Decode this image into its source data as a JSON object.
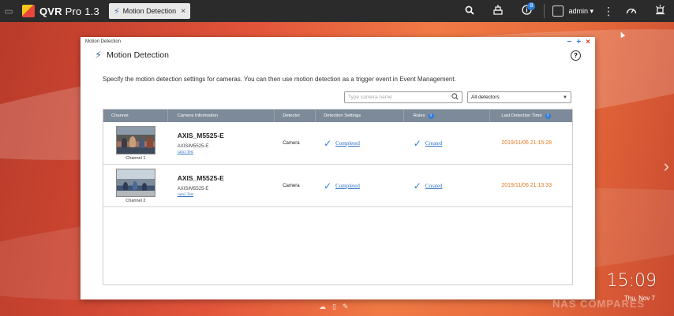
{
  "taskbar": {
    "app_name": "QVR",
    "app_suffix": "Pro 1.3",
    "tab_label": "Motion Detection",
    "notification_count": "8",
    "user": "admin ▾"
  },
  "window": {
    "titlebar": "Motion Detection",
    "header_title": "Motion Detection",
    "description": "Specify the motion detection settings for cameras. You can then use motion detection as a trigger event in Event Management.",
    "search_placeholder": "Type camera name",
    "detector_filter": "All detectors"
  },
  "table": {
    "headers": {
      "channel": "Channel",
      "camera_info": "Camera Information",
      "detector": "Detector",
      "detection_settings": "Detection Settings",
      "rules": "Rules",
      "last_detection": "Last Detection Time"
    },
    "rows": [
      {
        "channel": "Channel 1",
        "model": "AXIS_M5525-E",
        "sub": "AXIS/M5525-E",
        "link": "cam1 Test",
        "detector": "Camera",
        "settings": "Completed",
        "rules": "Created",
        "last_time": "2019/11/06 21:15:28"
      },
      {
        "channel": "Channel 2",
        "model": "AXIS_M5525-E",
        "sub": "AXIS/M5525-E",
        "link": "cam2 Test",
        "detector": "Camera",
        "settings": "Completed",
        "rules": "Created",
        "last_time": "2019/11/06 21:13:33"
      }
    ]
  },
  "desktop": {
    "clock": "15:09",
    "date": "Thu, Nov 7",
    "watermark": "NAS COMPARES"
  },
  "colors": {
    "accent": "#2d7de0",
    "header_bg": "#7c8a99",
    "time_color": "#e07a20",
    "close": "#d9392b"
  }
}
